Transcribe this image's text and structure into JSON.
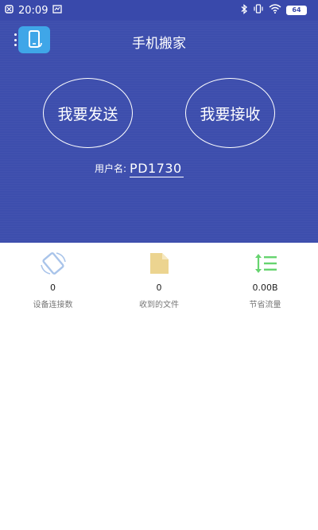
{
  "status_bar": {
    "time": "20:09",
    "battery": "64",
    "icons": [
      "notification-icon",
      "screenshot-icon",
      "bluetooth-icon",
      "vibrate-icon",
      "wifi-icon",
      "battery-icon"
    ]
  },
  "header": {
    "title": "手机搬家",
    "menu_icon": "menu-dots-icon",
    "app_icon": "phone-transfer-icon"
  },
  "actions": {
    "send_label": "我要发送",
    "receive_label": "我要接收"
  },
  "user": {
    "label": "用户名:",
    "value": "PD1730"
  },
  "stats": [
    {
      "icon": "device-connect-icon",
      "value": "0",
      "label": "设备连接数",
      "color": "#a9c4ea"
    },
    {
      "icon": "file-icon",
      "value": "0",
      "label": "收到的文件",
      "color": "#ecd490"
    },
    {
      "icon": "data-saving-icon",
      "value": "0.00B",
      "label": "节省流量",
      "color": "#66d46f"
    }
  ],
  "colors": {
    "primary": "#3d4ead",
    "status_bar": "#3949ab",
    "app_icon": "#3fa6e8"
  }
}
